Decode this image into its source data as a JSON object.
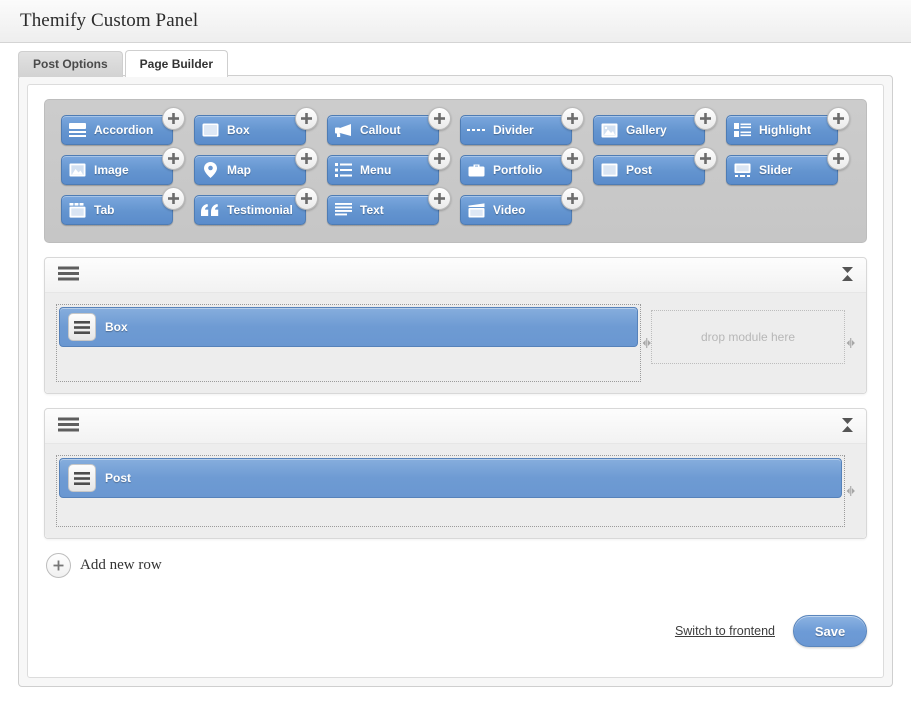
{
  "window": {
    "title": "Themify Custom Panel"
  },
  "tabs": [
    {
      "label": "Post Options",
      "active": false
    },
    {
      "label": "Page Builder",
      "active": true
    }
  ],
  "palette": {
    "modules": [
      {
        "label": "Accordion",
        "icon": "accordion-icon"
      },
      {
        "label": "Box",
        "icon": "box-icon"
      },
      {
        "label": "Callout",
        "icon": "megaphone-icon"
      },
      {
        "label": "Divider",
        "icon": "dashed-line-icon"
      },
      {
        "label": "Gallery",
        "icon": "gallery-icon"
      },
      {
        "label": "Highlight",
        "icon": "highlight-icon"
      },
      {
        "label": "Image",
        "icon": "image-icon"
      },
      {
        "label": "Map",
        "icon": "map-pin-icon"
      },
      {
        "label": "Menu",
        "icon": "menu-list-icon"
      },
      {
        "label": "Portfolio",
        "icon": "briefcase-icon"
      },
      {
        "label": "Post",
        "icon": "post-icon"
      },
      {
        "label": "Slider",
        "icon": "slider-icon"
      },
      {
        "label": "Tab",
        "icon": "tab-icon"
      },
      {
        "label": "Testimonial",
        "icon": "quote-icon"
      },
      {
        "label": "Text",
        "icon": "text-lines-icon"
      },
      {
        "label": "Video",
        "icon": "clapperboard-icon"
      }
    ],
    "add_badge": "+"
  },
  "rows": [
    {
      "module": "Box",
      "dropzone_text": "drop module here",
      "has_dropzone": true
    },
    {
      "module": "Post",
      "dropzone_text": "",
      "has_dropzone": false
    }
  ],
  "add_row": {
    "label": "Add new row",
    "icon_glyph": "+"
  },
  "footer": {
    "switch_label": "Switch to frontend",
    "save_label": "Save"
  },
  "colors": {
    "module_blue": "#6a97d1",
    "panel_gray": "#c8c8c8",
    "row_body": "#ededed",
    "accent_text": "#ffffff"
  }
}
